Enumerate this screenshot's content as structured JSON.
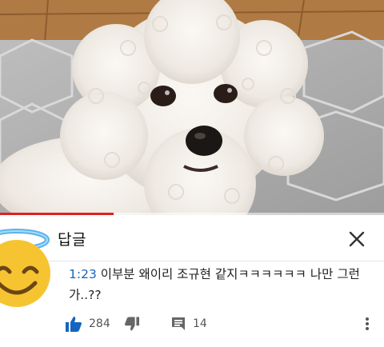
{
  "video": {
    "thumbnail_icon": "white-poodle-dog-photo",
    "progress_fraction": 0.295,
    "progress_color": "#e0201f"
  },
  "panel": {
    "title": "답글",
    "close_icon": "close-icon"
  },
  "comment": {
    "avatar_icon": "smiling-face-with-halo-emoji",
    "timestamp": "1:23",
    "text": " 이부분 왜이리 조규현 같지ㅋㅋㅋㅋㅋㅋ 나만 그런가..??",
    "like_count": "284",
    "reply_count": "14",
    "link_color": "#1565c0"
  }
}
